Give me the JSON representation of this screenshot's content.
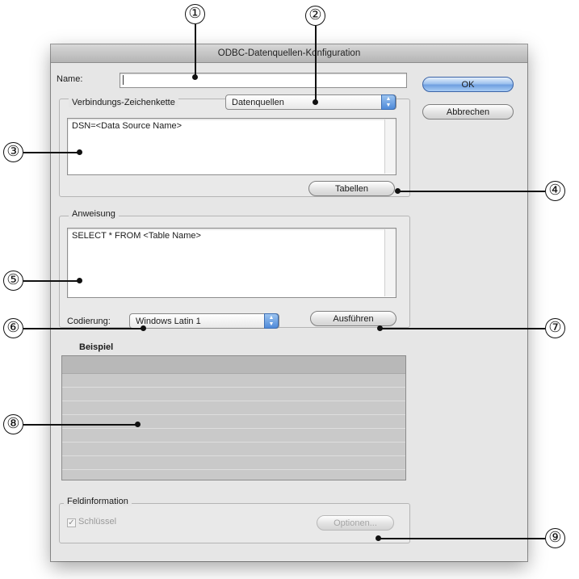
{
  "window": {
    "title": "ODBC-Datenquellen-Konfiguration"
  },
  "name_field": {
    "label": "Name:",
    "value": ""
  },
  "buttons": {
    "ok": "OK",
    "cancel": "Abbrechen",
    "tables": "Tabellen",
    "execute": "Ausführen",
    "options": "Optionen..."
  },
  "connection": {
    "legend": "Verbindungs-Zeichenkette",
    "source_popup": "Datenquellen",
    "text": "DSN=<Data Source Name>"
  },
  "statement": {
    "legend": "Anweisung",
    "text": "SELECT * FROM <Table Name>",
    "encoding_label": "Codierung:",
    "encoding_value": "Windows Latin 1"
  },
  "example": {
    "legend": "Beispiel",
    "row_count": 8
  },
  "field_info": {
    "legend": "Feldinformation",
    "key_label": "Schlüssel",
    "key_checked": true
  },
  "callouts": [
    "①",
    "②",
    "③",
    "④",
    "⑤",
    "⑥",
    "⑦",
    "⑧",
    "⑨"
  ],
  "icons": {
    "popup_arrows": "updown-arrows-icon",
    "checkbox": "checkmark-icon"
  }
}
